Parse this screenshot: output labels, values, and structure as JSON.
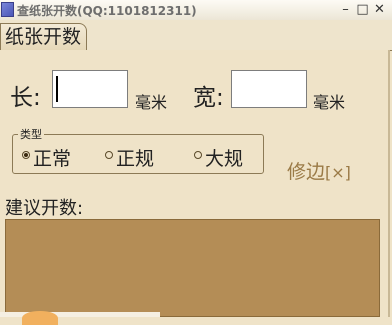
{
  "window": {
    "title": "查纸张开数(QQ:1101812311)",
    "minimize_glyph": "–",
    "maximize_glyph": "□",
    "close_glyph": "✕"
  },
  "tabs": [
    {
      "label": "纸张开数",
      "active": true
    }
  ],
  "form": {
    "length_label": "长:",
    "length_value": "",
    "length_unit": "毫米",
    "width_label": "宽:",
    "width_value": "",
    "width_unit": "毫米"
  },
  "type_group": {
    "title": "类型",
    "options": [
      {
        "label": "正常",
        "selected": true
      },
      {
        "label": "正规",
        "selected": false
      },
      {
        "label": "大规",
        "selected": false
      }
    ]
  },
  "edge_toggle": {
    "label": "修边",
    "mark": "[×]"
  },
  "result": {
    "label": "建议开数:",
    "value": ""
  },
  "colors": {
    "background": "#efe3c8",
    "result_box": "#b48d56",
    "edge_link": "#9a7a46",
    "app_icon": "#5a66c8"
  }
}
